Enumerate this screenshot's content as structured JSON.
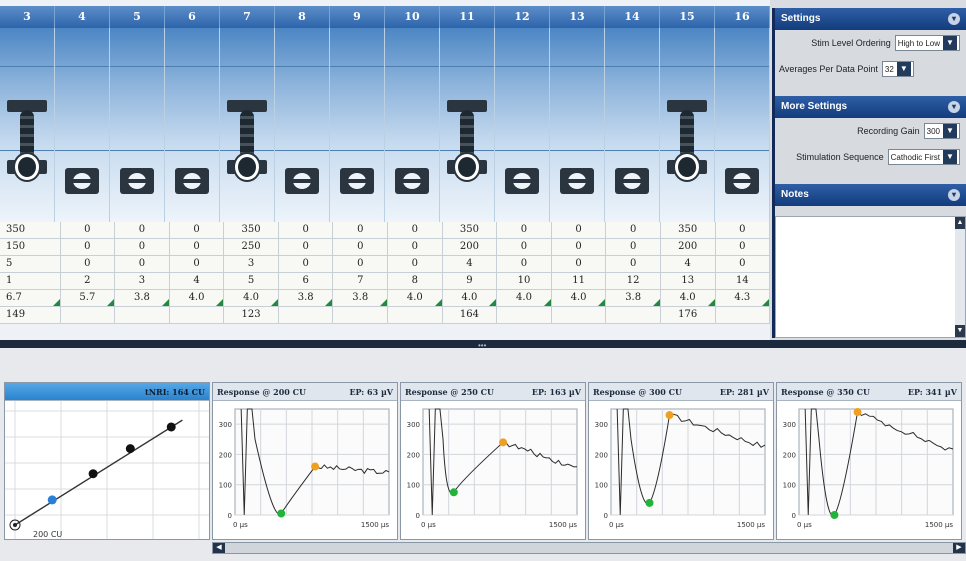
{
  "columns": [
    "3",
    "4",
    "5",
    "6",
    "7",
    "8",
    "9",
    "10",
    "11",
    "12",
    "13",
    "14",
    "15",
    "16"
  ],
  "electrode_active": [
    true,
    false,
    false,
    false,
    true,
    false,
    false,
    false,
    true,
    false,
    false,
    false,
    true,
    false
  ],
  "value_rows": [
    [
      "350",
      "0",
      "0",
      "0",
      "350",
      "0",
      "0",
      "0",
      "350",
      "0",
      "0",
      "0",
      "350",
      "0"
    ],
    [
      "150",
      "0",
      "0",
      "0",
      "250",
      "0",
      "0",
      "0",
      "200",
      "0",
      "0",
      "0",
      "200",
      "0"
    ],
    [
      "5",
      "0",
      "0",
      "0",
      "3",
      "0",
      "0",
      "0",
      "4",
      "0",
      "0",
      "0",
      "4",
      "0"
    ],
    [
      "1",
      "2",
      "3",
      "4",
      "5",
      "6",
      "7",
      "8",
      "9",
      "10",
      "11",
      "12",
      "13",
      "14"
    ],
    [
      "6.7",
      "5.7",
      "3.8",
      "4.0",
      "4.0",
      "3.8",
      "3.8",
      "4.0",
      "4.0",
      "4.0",
      "4.0",
      "3.8",
      "4.0",
      "4.3"
    ],
    [
      "149",
      "",
      "",
      "",
      "123",
      "",
      "",
      "",
      "164",
      "",
      "",
      "",
      "176",
      ""
    ]
  ],
  "settings": {
    "title": "Settings",
    "stim_level_ordering_label": "Stim Level Ordering",
    "stim_level_ordering_value": "High to Low",
    "averages_label": "Averages Per Data Point",
    "averages_value": "32"
  },
  "more_settings": {
    "title": "More Settings",
    "recording_gain_label": "Recording Gain",
    "recording_gain_value": "300",
    "stim_sequence_label": "Stimulation Sequence",
    "stim_sequence_value": "Cathodic First"
  },
  "notes": {
    "title": "Notes"
  },
  "growth": {
    "title": "tNRI: 164 CU",
    "x_label": "200 CU",
    "points": [
      [
        0.2,
        0.22
      ],
      [
        0.42,
        0.45
      ],
      [
        0.62,
        0.67
      ],
      [
        0.84,
        0.86
      ]
    ],
    "colors": {
      "point": "#111111",
      "selected": "#2a7fd6",
      "line": "#333333"
    }
  },
  "responses": [
    {
      "title": "Response @ 200 CU",
      "ep": "EP: 63 µV",
      "y_ticks": [
        "300",
        "200",
        "100",
        "0"
      ],
      "x_start": "0 µs",
      "x_end": "1500 µs",
      "trough": [
        0.3,
        5
      ],
      "peak": [
        0.52,
        160
      ],
      "tail": 140
    },
    {
      "title": "Response @ 250 CU",
      "ep": "EP: 163 µV",
      "y_ticks": [
        "300",
        "200",
        "100",
        "0"
      ],
      "x_start": "0 µs",
      "x_end": "1500 µs",
      "trough": [
        0.2,
        75
      ],
      "peak": [
        0.52,
        240
      ],
      "tail": 155
    },
    {
      "title": "Response @ 300 CU",
      "ep": "EP: 281 µV",
      "y_ticks": [
        "300",
        "200",
        "100",
        "0"
      ],
      "x_start": "0 µs",
      "x_end": "1500 µs",
      "trough": [
        0.25,
        40
      ],
      "peak": [
        0.38,
        330
      ],
      "tail": 225
    },
    {
      "title": "Response @ 350 CU",
      "ep": "EP: 341 µV",
      "y_ticks": [
        "300",
        "200",
        "100",
        "0"
      ],
      "x_start": "0 µs",
      "x_end": "1500 µs",
      "trough": [
        0.23,
        0
      ],
      "peak": [
        0.38,
        340
      ],
      "tail": 210
    }
  ],
  "trace_colors": {
    "trace": "#2b2b2b",
    "trough": "#22b33a",
    "peak": "#f0a020",
    "grid": "#d2d6da"
  }
}
